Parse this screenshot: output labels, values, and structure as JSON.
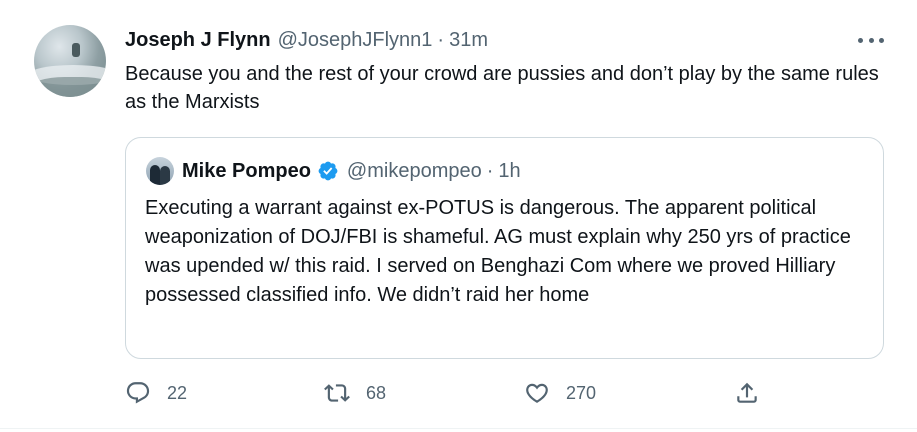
{
  "tweet": {
    "author_name": "Joseph J Flynn",
    "author_handle": "@JosephJFlynn1",
    "separator": "·",
    "time": "31m",
    "text": "Because you and the rest of your crowd are pussies and don’t play by the same rules as the Marxists",
    "avatar_icon": "profile-avatar-ocean",
    "more_icon": "more-horizontal-icon"
  },
  "quoted_tweet": {
    "author_name": "Mike Pompeo",
    "verified": true,
    "author_handle": "@mikepompeo",
    "separator": "·",
    "time": "1h",
    "text": "Executing a warrant against ex-POTUS is dangerous. The apparent political weaponization of DOJ/FBI is shameful. AG must explain why 250 yrs of practice was upended w/ this raid. I served on Benghazi Com where we proved Hilliary possessed classified info. We didn’t raid her home"
  },
  "actions": {
    "reply_count": "22",
    "retweet_count": "68",
    "like_count": "270"
  },
  "colors": {
    "text_primary": "#0f1419",
    "text_secondary": "#536471",
    "verified_blue": "#1d9bf0",
    "border": "#cfd9de"
  }
}
